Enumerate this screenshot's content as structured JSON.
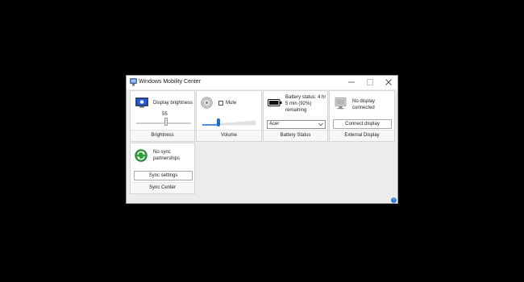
{
  "window": {
    "title": "Windows Mobility Center",
    "minimize_icon": "minimize-icon",
    "maximize_icon": "maximize-icon",
    "close_icon": "close-icon"
  },
  "brightness": {
    "label": "Display brightness",
    "value": "55",
    "level": 0.55,
    "footer": "Brightness",
    "icon": "display-brightness-icon"
  },
  "volume": {
    "mute_label": "Mute",
    "muted": false,
    "footer": "Volume",
    "icon": "speaker-icon"
  },
  "battery": {
    "status": "Battery status: 4 hr 5 min (92%) remaining",
    "plan": "Acer",
    "footer": "Battery Status",
    "percent": 92,
    "icon": "battery-icon"
  },
  "display": {
    "status": "No display connected",
    "button": "Connect display",
    "footer": "External Display",
    "icon": "external-display-icon"
  },
  "sync": {
    "status": "No sync partnerships",
    "button": "Sync settings",
    "footer": "Sync Center",
    "icon": "sync-icon"
  },
  "help": {
    "icon": "help-icon"
  },
  "colors": {
    "accent": "#1a6fd4",
    "sync_green": "#2e9e3a"
  }
}
